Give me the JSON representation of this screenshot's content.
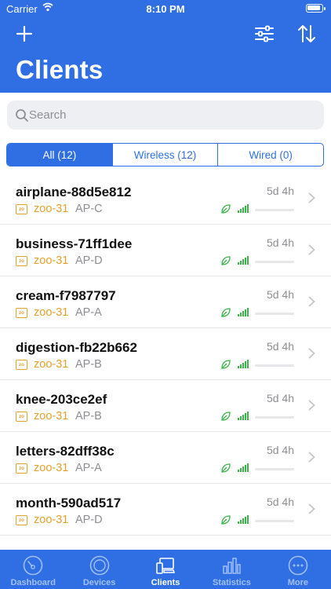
{
  "status_bar": {
    "carrier": "Carrier",
    "time": "8:10 PM"
  },
  "header": {
    "title": "Clients"
  },
  "search": {
    "placeholder": "Search"
  },
  "segments": [
    {
      "label": "All (12)",
      "active": true
    },
    {
      "label": "Wireless (12)",
      "active": false
    },
    {
      "label": "Wired (0)",
      "active": false
    }
  ],
  "clients": [
    {
      "name": "airplane-88d5e812",
      "site": "zoo-31",
      "ap": "AP-C",
      "uptime": "5d 4h"
    },
    {
      "name": "business-71ff1dee",
      "site": "zoo-31",
      "ap": "AP-D",
      "uptime": "5d 4h"
    },
    {
      "name": "cream-f7987797",
      "site": "zoo-31",
      "ap": "AP-A",
      "uptime": "5d 4h"
    },
    {
      "name": "digestion-fb22b662",
      "site": "zoo-31",
      "ap": "AP-B",
      "uptime": "5d 4h"
    },
    {
      "name": "knee-203ce2ef",
      "site": "zoo-31",
      "ap": "AP-B",
      "uptime": "5d 4h"
    },
    {
      "name": "letters-82dff38c",
      "site": "zoo-31",
      "ap": "AP-A",
      "uptime": "5d 4h"
    },
    {
      "name": "month-590ad517",
      "site": "zoo-31",
      "ap": "AP-D",
      "uptime": "5d 4h"
    }
  ],
  "site_icon_text": "zo",
  "tabs": [
    {
      "label": "Dashboard",
      "icon": "gauge-icon",
      "active": false
    },
    {
      "label": "Devices",
      "icon": "devices-icon",
      "active": false
    },
    {
      "label": "Clients",
      "icon": "clients-icon",
      "active": true
    },
    {
      "label": "Statistics",
      "icon": "statistics-icon",
      "active": false
    },
    {
      "label": "More",
      "icon": "more-icon",
      "active": false
    }
  ],
  "colors": {
    "primary": "#2f6fe3",
    "site": "#e8a02c",
    "signal": "#3bb54a",
    "muted": "#8e8e93"
  }
}
